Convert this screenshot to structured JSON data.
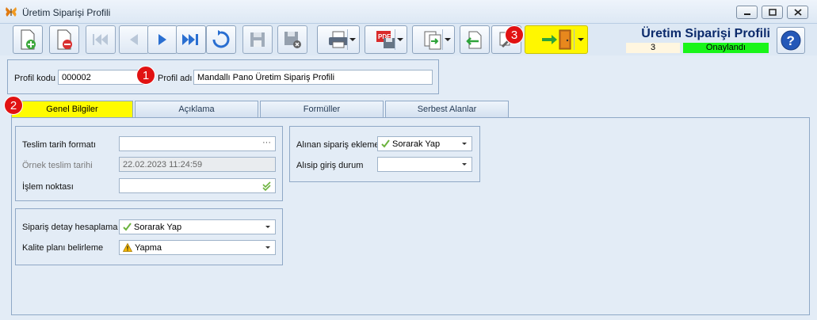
{
  "window": {
    "title": "Üretim Siparişi Profili",
    "minimize": "–",
    "maximize": "□",
    "close": "×"
  },
  "header": {
    "title": "Üretim Siparişi Profili",
    "number": "3",
    "status": "Onaylandı"
  },
  "toolbar": {
    "buttons": [
      "new-record",
      "delete-record",
      "first-record",
      "previous-record",
      "next-record",
      "last-record",
      "refresh",
      "save",
      "cancel-save",
      "print",
      "export-pdf",
      "copy",
      "import",
      "tools",
      "exit"
    ]
  },
  "profile": {
    "code_label": "Profil kodu",
    "code_value": "000002",
    "name_label": "Profil adı",
    "name_value": "Mandallı Pano Üretim Sipariş Profili"
  },
  "badges": [
    "1",
    "2",
    "3"
  ],
  "tabs": [
    {
      "label": "Genel Bilgiler",
      "active": true
    },
    {
      "label": "Açıklama"
    },
    {
      "label": "Formüller"
    },
    {
      "label": "Serbest Alanlar"
    }
  ],
  "general": {
    "date_format_label": "Teslim tarih formatı",
    "date_format_value": "",
    "date_format_btn": "···",
    "sample_date_label": "Örnek teslim tarihi",
    "sample_date_value": "22.02.2023 11:24:59",
    "process_point_label": "İşlem noktası",
    "process_point_value": "",
    "order_detail_label": "Sipariş detay hesaplama",
    "order_detail_value": "Sorarak Yap",
    "quality_plan_label": "Kalite planı belirleme",
    "quality_plan_value": "Yapma",
    "received_order_label": "Alınan sipariş ekleme",
    "received_order_value": "Sorarak Yap",
    "entry_status_label": "Alısip giriş durum",
    "entry_status_value": ""
  },
  "colors": {
    "highlight": "#fffb00",
    "badge": "#e11212",
    "status": "#19f519"
  }
}
